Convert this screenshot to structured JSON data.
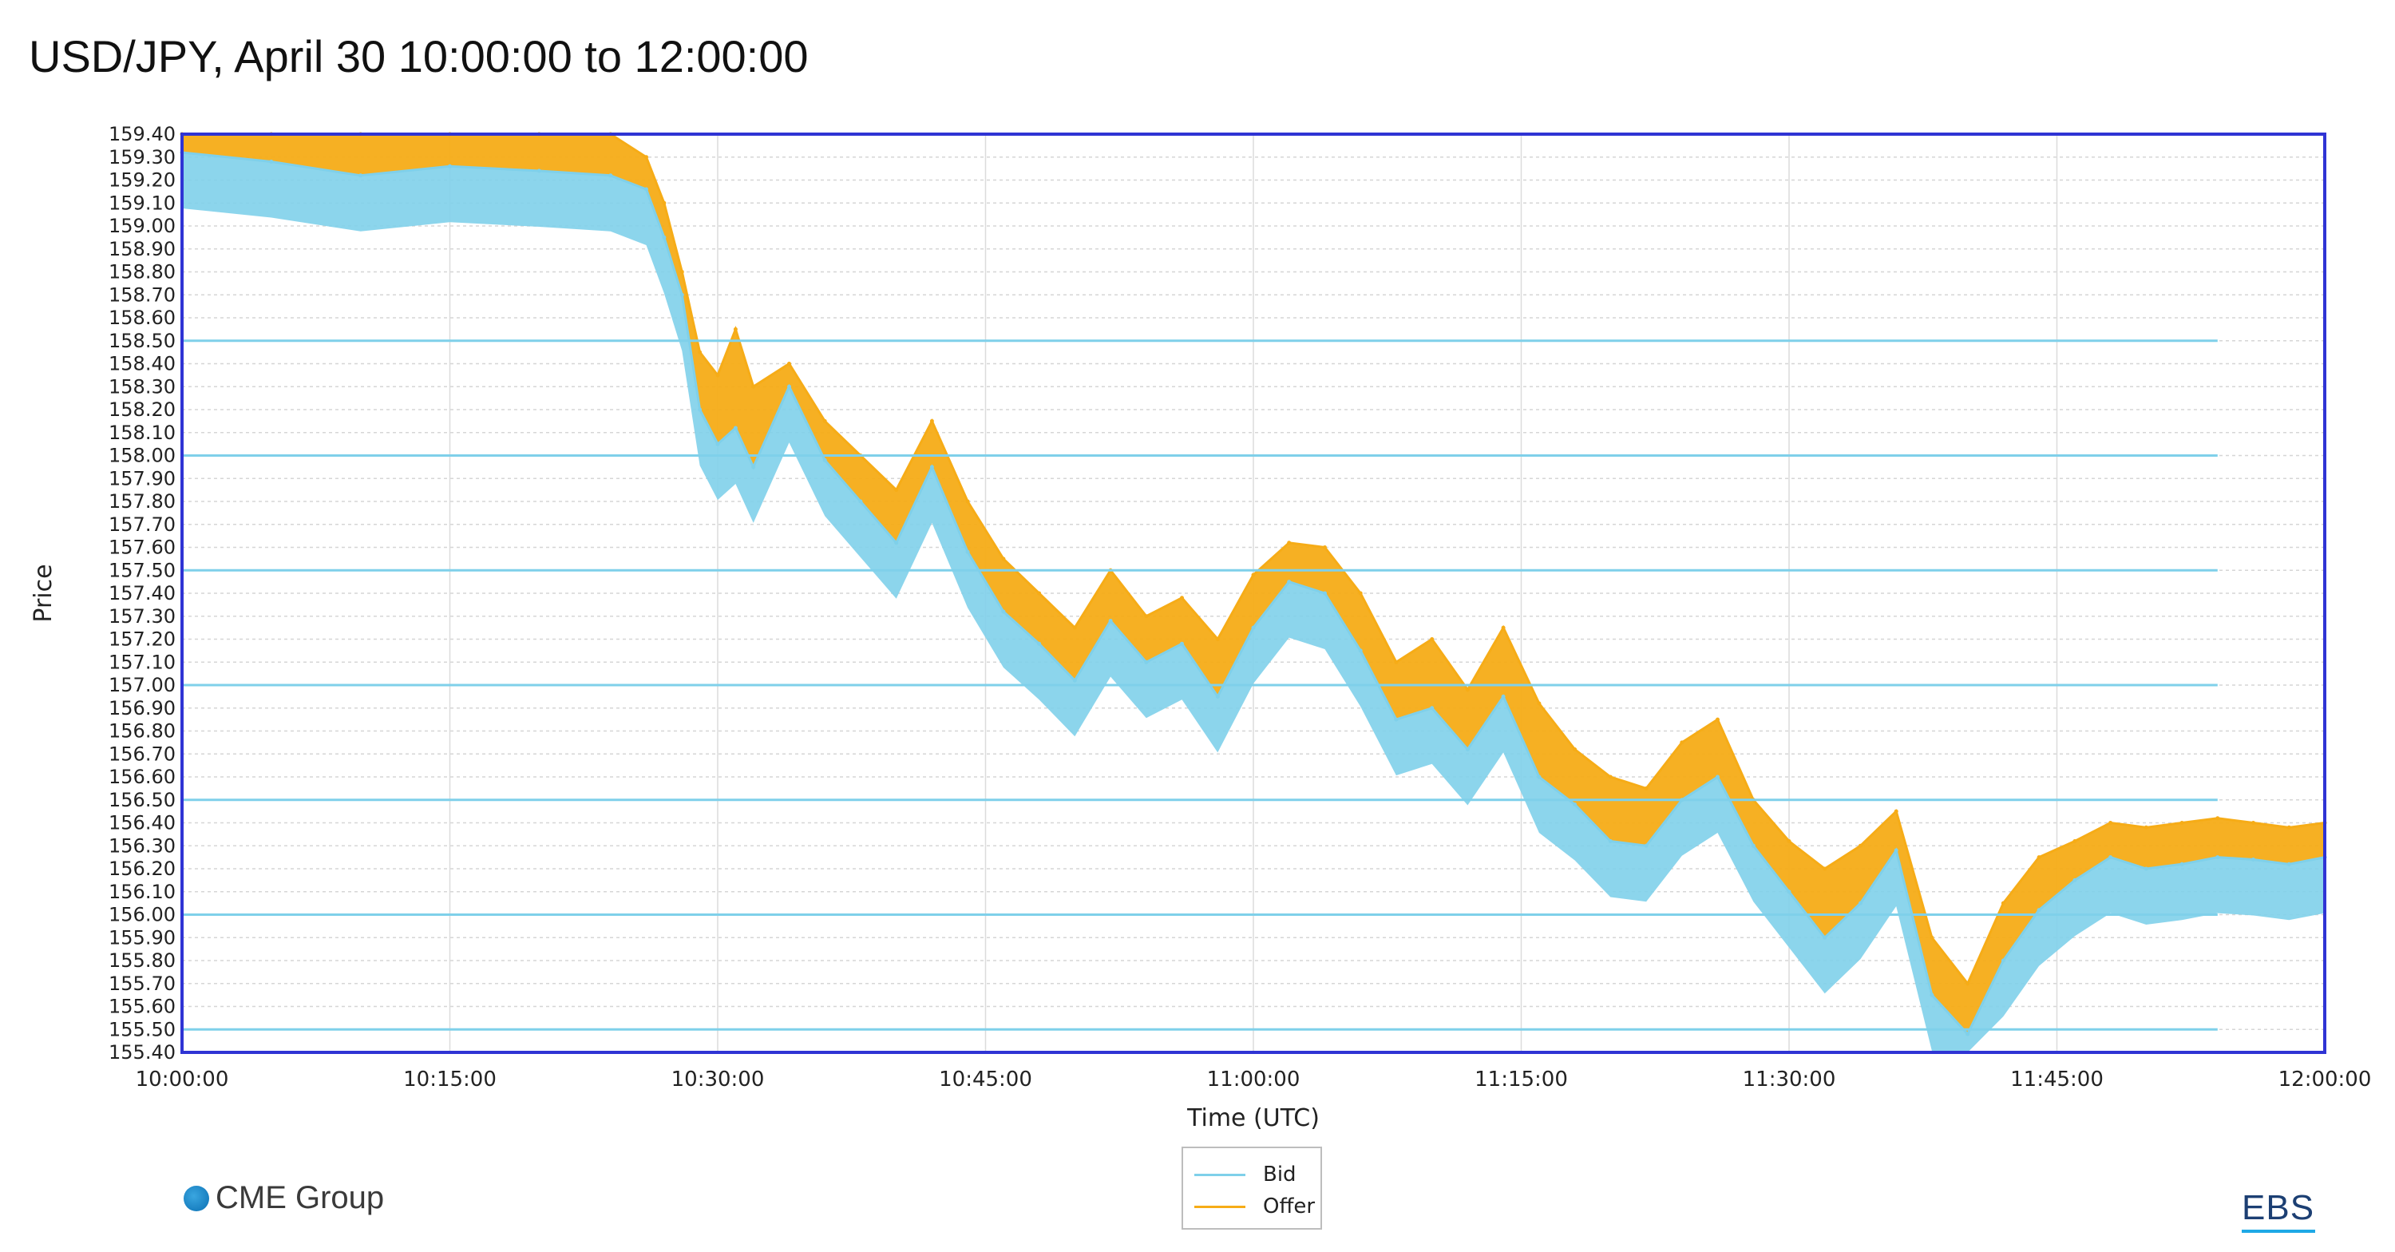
{
  "chart_data": {
    "type": "area",
    "title": "USD/JPY, April 30 10:00:00 to 12:00:00",
    "xlabel": "Time (UTC)",
    "ylabel": "Price",
    "ylim": [
      155.4,
      159.4
    ],
    "y_ticks": [
      "159.40",
      "159.30",
      "159.20",
      "159.10",
      "159.00",
      "158.90",
      "158.80",
      "158.70",
      "158.60",
      "158.50",
      "158.40",
      "158.30",
      "158.20",
      "158.10",
      "158.00",
      "157.90",
      "157.80",
      "157.70",
      "157.60",
      "157.50",
      "157.40",
      "157.30",
      "157.20",
      "157.10",
      "157.00",
      "156.90",
      "156.80",
      "156.70",
      "156.60",
      "156.50",
      "156.40",
      "156.30",
      "156.20",
      "156.10",
      "156.00",
      "155.90",
      "155.80",
      "155.70",
      "155.60",
      "155.50",
      "155.40"
    ],
    "x_ticks": [
      "10:00:00",
      "10:15:00",
      "10:30:00",
      "10:45:00",
      "11:00:00",
      "11:15:00",
      "11:30:00",
      "11:45:00",
      "12:00:00"
    ],
    "x_minutes": [
      0,
      5,
      10,
      15,
      20,
      24,
      26,
      27,
      28,
      29,
      30,
      31,
      32,
      34,
      36,
      38,
      40,
      42,
      44,
      46,
      48,
      50,
      52,
      54,
      56,
      58,
      60,
      62,
      64,
      66,
      68,
      70,
      72,
      74,
      76,
      78,
      80,
      82,
      84,
      86,
      88,
      90,
      92,
      94,
      96,
      98,
      100,
      102,
      104,
      106,
      108,
      110,
      112,
      114,
      116,
      118,
      120
    ],
    "legend_position": "bottom-center",
    "grid": true,
    "series": [
      {
        "name": "Bid",
        "color": "#7fd0ea",
        "values": [
          159.32,
          159.28,
          159.22,
          159.26,
          159.24,
          159.22,
          159.16,
          158.95,
          158.7,
          158.2,
          158.05,
          158.12,
          157.95,
          158.3,
          157.98,
          157.8,
          157.62,
          157.95,
          157.58,
          157.32,
          157.18,
          157.02,
          157.28,
          157.1,
          157.18,
          156.95,
          157.25,
          157.45,
          157.4,
          157.15,
          156.85,
          156.9,
          156.72,
          156.95,
          156.6,
          156.48,
          156.32,
          156.3,
          156.5,
          156.6,
          156.3,
          156.1,
          155.9,
          156.05,
          156.28,
          155.65,
          155.48,
          155.8,
          156.02,
          156.15,
          156.25,
          156.2,
          156.22,
          156.25,
          156.24,
          156.22,
          156.25
        ]
      },
      {
        "name": "Offer",
        "color": "#f6ac17",
        "values": [
          159.4,
          159.4,
          159.4,
          159.4,
          159.4,
          159.4,
          159.3,
          159.1,
          158.8,
          158.45,
          158.35,
          158.55,
          158.3,
          158.4,
          158.15,
          158.0,
          157.85,
          158.15,
          157.8,
          157.55,
          157.4,
          157.25,
          157.5,
          157.3,
          157.38,
          157.2,
          157.48,
          157.62,
          157.6,
          157.4,
          157.1,
          157.2,
          156.98,
          157.25,
          156.92,
          156.72,
          156.6,
          156.55,
          156.75,
          156.85,
          156.5,
          156.32,
          156.2,
          156.3,
          156.45,
          155.9,
          155.7,
          156.05,
          156.25,
          156.32,
          156.4,
          156.38,
          156.4,
          156.42,
          156.4,
          156.38,
          156.4
        ]
      }
    ]
  },
  "logos": {
    "left": "CME Group",
    "right": "EBS"
  }
}
